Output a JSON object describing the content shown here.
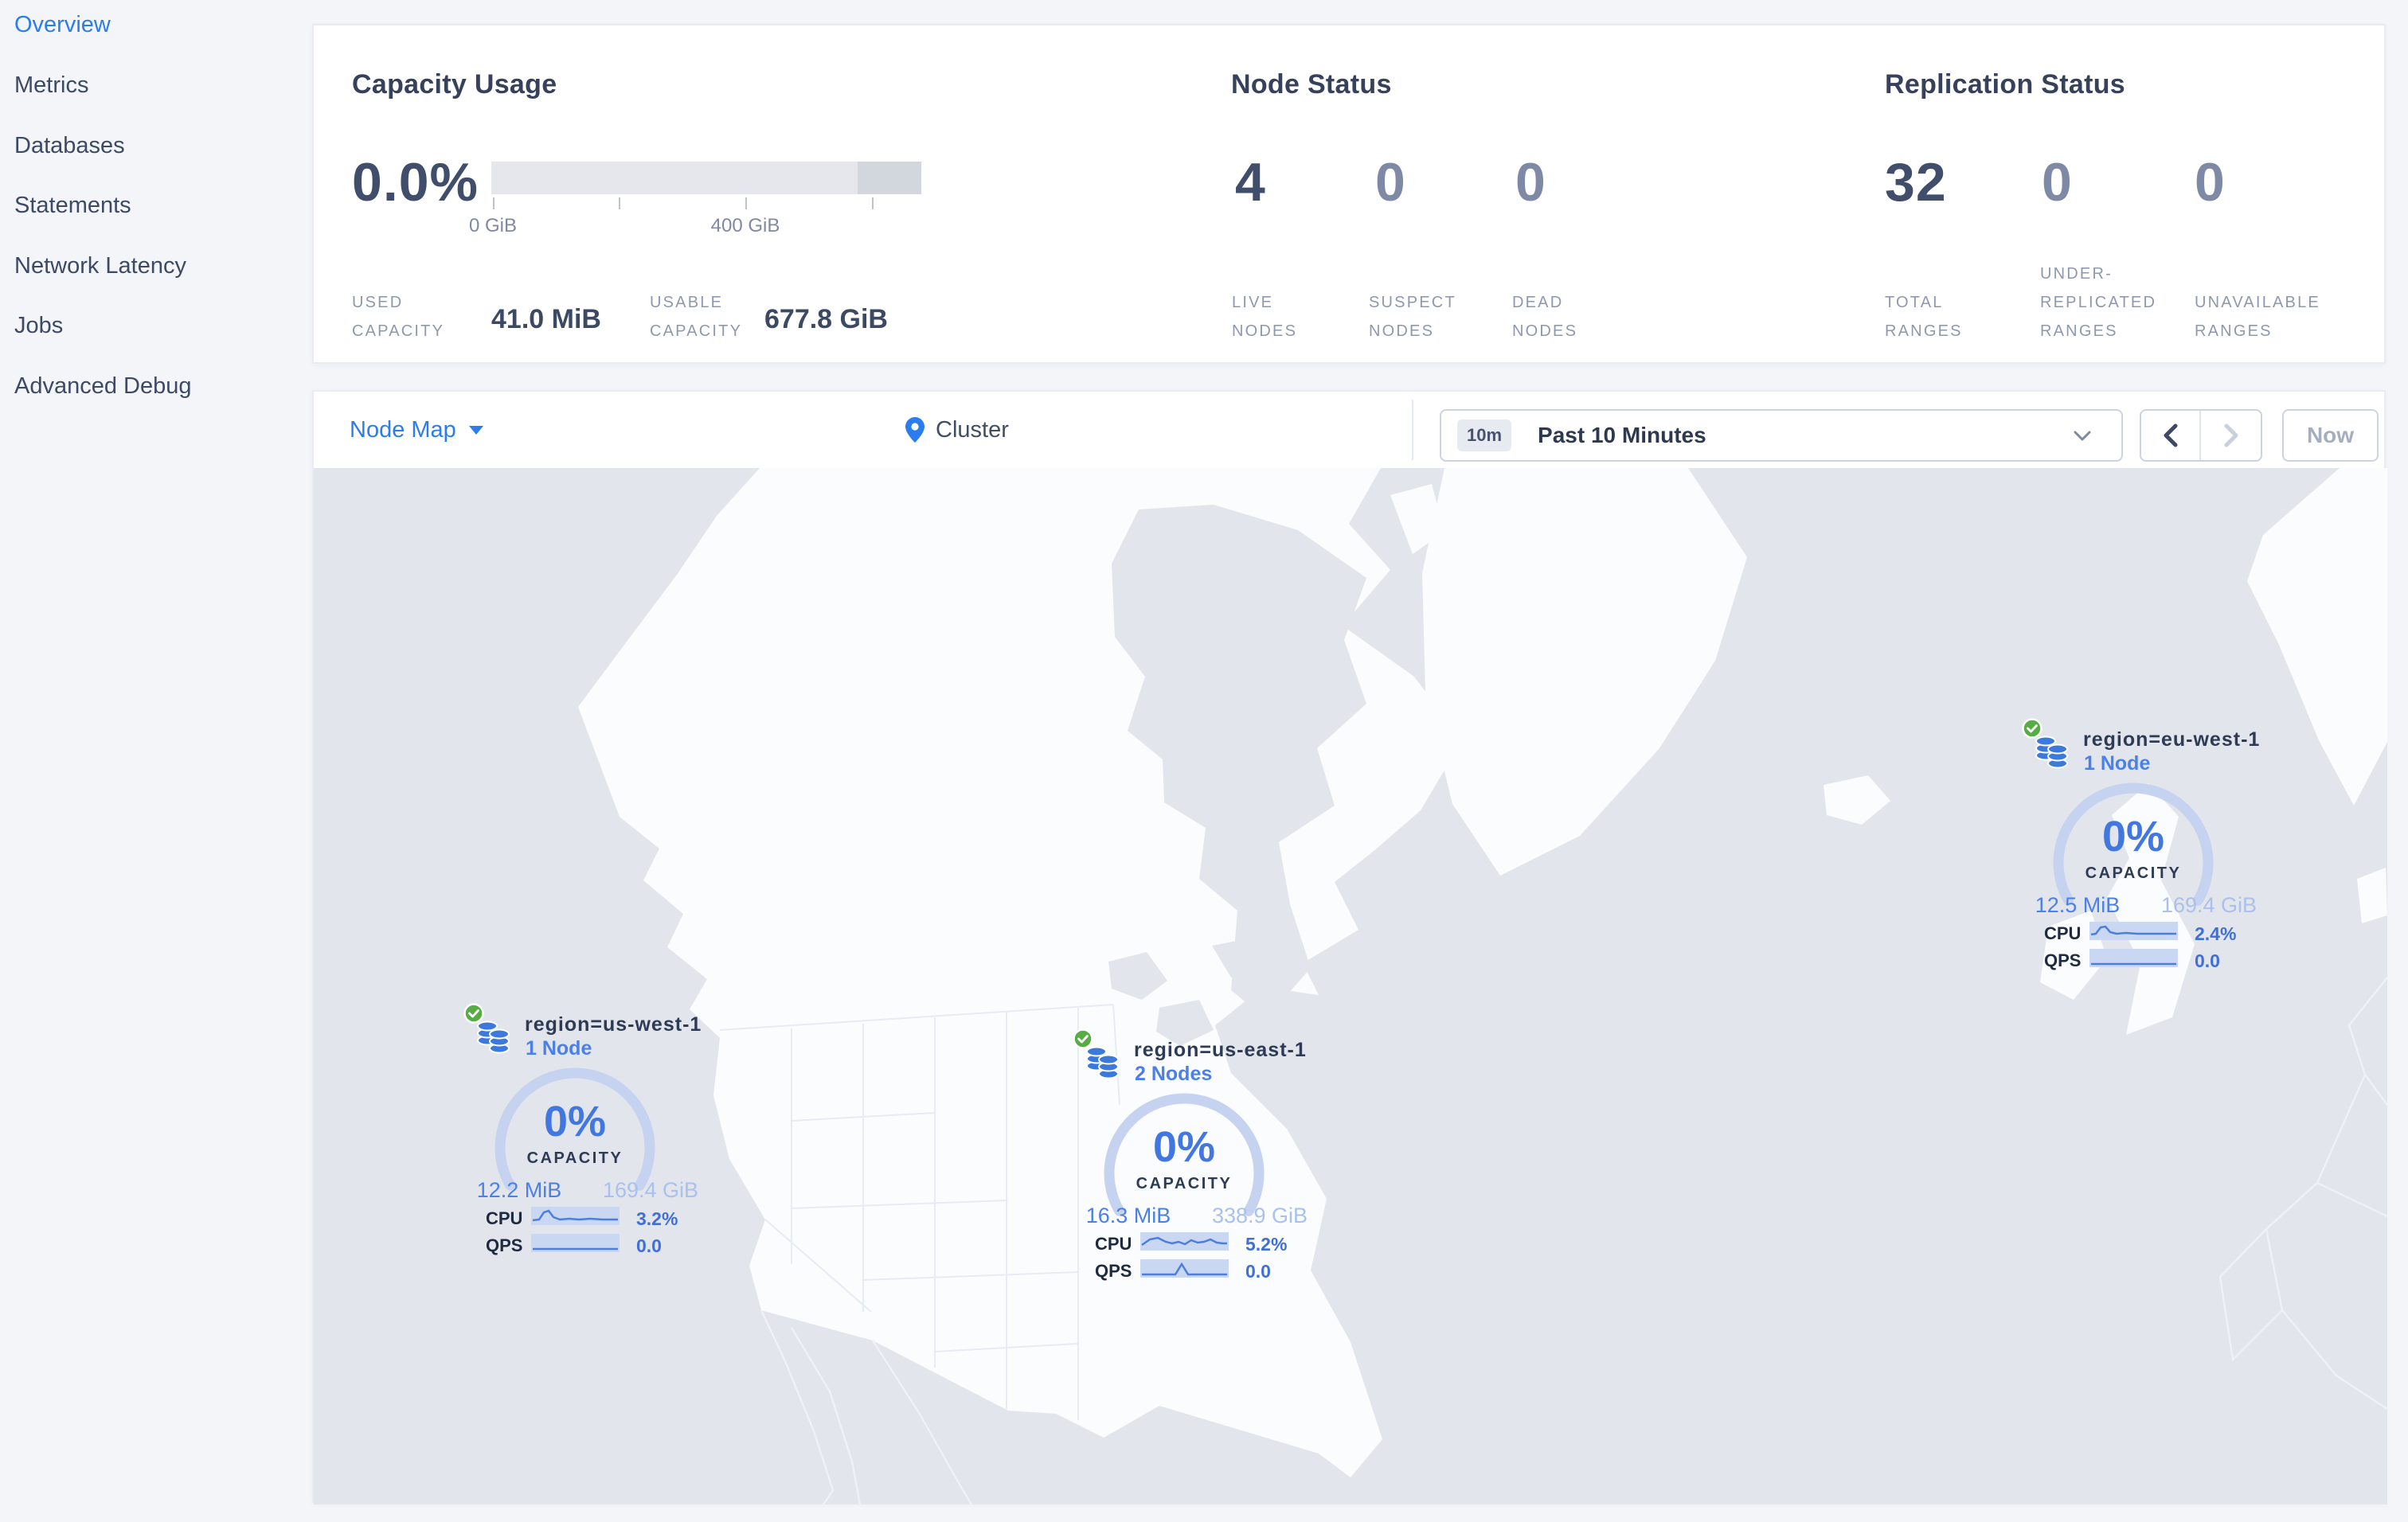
{
  "colors": {
    "accent_blue": "#2b7cec",
    "link_blue": "#4a80e8",
    "text_dark": "#3e4a63",
    "muted_label": "#8e98ae",
    "ok_green": "#57ad43",
    "ocean": "#e2e5eb",
    "land": "#fbfcfd"
  },
  "sidebar": {
    "items": [
      {
        "label": "Overview"
      },
      {
        "label": "Metrics"
      },
      {
        "label": "Databases"
      },
      {
        "label": "Statements"
      },
      {
        "label": "Network Latency"
      },
      {
        "label": "Jobs"
      },
      {
        "label": "Advanced Debug"
      }
    ]
  },
  "summary": {
    "capacity": {
      "title": "Capacity Usage",
      "percent": "0.0%",
      "tick_low": "0 GiB",
      "tick_mid": "400 GiB",
      "used_label": "USED\nCAPACITY",
      "used_value": "41.0 MiB",
      "usable_label": "USABLE\nCAPACITY",
      "usable_value": "677.8 GiB"
    },
    "nodes": {
      "title": "Node Status",
      "live_value": "4",
      "live_label": "LIVE\nNODES",
      "suspect_value": "0",
      "suspect_label": "SUSPECT\nNODES",
      "dead_value": "0",
      "dead_label": "DEAD\nNODES"
    },
    "replication": {
      "title": "Replication Status",
      "total_value": "32",
      "total_label": "TOTAL\nRANGES",
      "under_value": "0",
      "under_label": "UNDER-\nREPLICATED\nRANGES",
      "unavail_value": "0",
      "unavail_label": "UNAVAILABLE\nRANGES"
    }
  },
  "toolbar": {
    "view": "Node Map",
    "breadcrumb": "Cluster",
    "time_badge": "10m",
    "time_range": "Past 10 Minutes",
    "now": "Now"
  },
  "map": {
    "regions": [
      {
        "name": "region=us-west-1",
        "nodes": "1 Node",
        "pct": "0%",
        "cap_label": "CAPACITY",
        "used": "12.2 MiB",
        "total": "169.4 GiB",
        "cpu_label": "CPU",
        "cpu": "3.2%",
        "qps_label": "QPS",
        "qps": "0.0"
      },
      {
        "name": "region=us-east-1",
        "nodes": "2 Nodes",
        "pct": "0%",
        "cap_label": "CAPACITY",
        "used": "16.3 MiB",
        "total": "338.9 GiB",
        "cpu_label": "CPU",
        "cpu": "5.2%",
        "qps_label": "QPS",
        "qps": "0.0"
      },
      {
        "name": "region=eu-west-1",
        "nodes": "1 Node",
        "pct": "0%",
        "cap_label": "CAPACITY",
        "used": "12.5 MiB",
        "total": "169.4 GiB",
        "cpu_label": "CPU",
        "cpu": "2.4%",
        "qps_label": "QPS",
        "qps": "0.0"
      }
    ]
  }
}
